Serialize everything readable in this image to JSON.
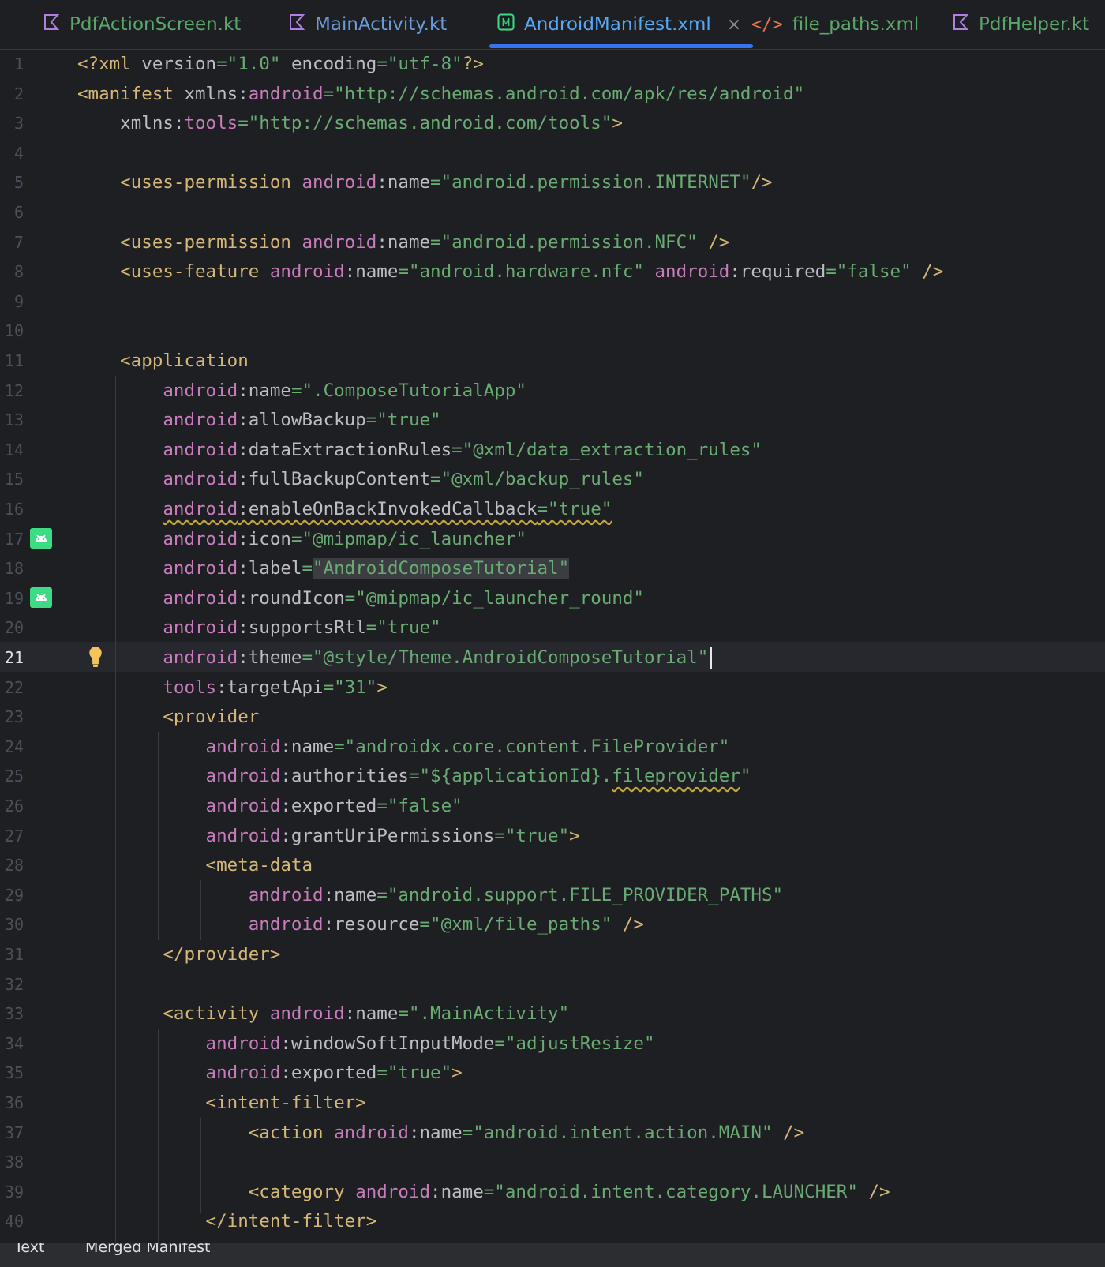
{
  "tabs": [
    {
      "label": "PdfActionScreen.kt",
      "icon": "kotlin-file-icon",
      "active": false
    },
    {
      "label": "MainActivity.kt",
      "icon": "kotlin-file-icon",
      "active": false
    },
    {
      "label": "AndroidManifest.xml",
      "icon": "manifest-file-icon",
      "active": true
    },
    {
      "label": "file_paths.xml",
      "icon": "xml-file-icon",
      "active": false
    },
    {
      "label": "PdfHelper.kt",
      "icon": "kotlin-file-icon",
      "active": false
    }
  ],
  "tab_close": "×",
  "lines": [
    {
      "n": "1",
      "segs": [
        {
          "c": "tag",
          "t": "<?xml "
        },
        {
          "c": "txt",
          "t": "version"
        },
        {
          "c": "str",
          "t": "=\"1.0\" "
        },
        {
          "c": "txt",
          "t": "encoding"
        },
        {
          "c": "str",
          "t": "=\"utf-8\""
        },
        {
          "c": "tag",
          "t": "?>"
        }
      ]
    },
    {
      "n": "2",
      "segs": [
        {
          "c": "tag",
          "t": "<manifest "
        },
        {
          "c": "txt",
          "t": "xmlns:"
        },
        {
          "c": "ns",
          "t": "android"
        },
        {
          "c": "str",
          "t": "=\"http://schemas.android.com/apk/res/android\""
        }
      ]
    },
    {
      "n": "3",
      "segs": [
        {
          "c": "txt",
          "t": "    xmlns:"
        },
        {
          "c": "ns",
          "t": "tools"
        },
        {
          "c": "str",
          "t": "=\"http://schemas.android.com/tools\""
        },
        {
          "c": "tag",
          "t": ">"
        }
      ]
    },
    {
      "n": "4",
      "segs": []
    },
    {
      "n": "5",
      "segs": [
        {
          "c": "tag",
          "t": "    <uses-permission "
        },
        {
          "c": "ns",
          "t": "android"
        },
        {
          "c": "txt",
          "t": ":name"
        },
        {
          "c": "str",
          "t": "=\"android.permission.INTERNET\""
        },
        {
          "c": "tag",
          "t": "/>"
        }
      ]
    },
    {
      "n": "6",
      "segs": []
    },
    {
      "n": "7",
      "segs": [
        {
          "c": "tag",
          "t": "    <uses-permission "
        },
        {
          "c": "ns",
          "t": "android"
        },
        {
          "c": "txt",
          "t": ":name"
        },
        {
          "c": "str",
          "t": "=\"android.permission.NFC\" "
        },
        {
          "c": "tag",
          "t": "/>"
        }
      ]
    },
    {
      "n": "8",
      "segs": [
        {
          "c": "tag",
          "t": "    <uses-feature "
        },
        {
          "c": "ns",
          "t": "android"
        },
        {
          "c": "txt",
          "t": ":name"
        },
        {
          "c": "str",
          "t": "=\"android.hardware.nfc\" "
        },
        {
          "c": "ns",
          "t": "android"
        },
        {
          "c": "txt",
          "t": ":required"
        },
        {
          "c": "str",
          "t": "=\"false\" "
        },
        {
          "c": "tag",
          "t": "/>"
        }
      ]
    },
    {
      "n": "9",
      "segs": []
    },
    {
      "n": "10",
      "segs": []
    },
    {
      "n": "11",
      "segs": [
        {
          "c": "tag",
          "t": "    <application"
        }
      ]
    },
    {
      "n": "12",
      "segs": [
        {
          "c": "ns",
          "t": "        android"
        },
        {
          "c": "txt",
          "t": ":name"
        },
        {
          "c": "str",
          "t": "=\".ComposeTutorialApp\""
        }
      ]
    },
    {
      "n": "13",
      "segs": [
        {
          "c": "ns",
          "t": "        android"
        },
        {
          "c": "txt",
          "t": ":allowBackup"
        },
        {
          "c": "str",
          "t": "=\"true\""
        }
      ]
    },
    {
      "n": "14",
      "segs": [
        {
          "c": "ns",
          "t": "        android"
        },
        {
          "c": "txt",
          "t": ":dataExtractionRules"
        },
        {
          "c": "str",
          "t": "=\"@xml/data_extraction_rules\""
        }
      ]
    },
    {
      "n": "15",
      "segs": [
        {
          "c": "ns",
          "t": "        android"
        },
        {
          "c": "txt",
          "t": ":fullBackupContent"
        },
        {
          "c": "str",
          "t": "=\"@xml/backup_rules\""
        }
      ]
    },
    {
      "n": "16",
      "segs": [
        {
          "c": "txt",
          "t": "        "
        },
        {
          "c": "ns wavy",
          "t": "android"
        },
        {
          "c": "txt wavy",
          "t": ":enableOnBackInvokedCallback"
        },
        {
          "c": "str wavy",
          "t": "=\"true\""
        }
      ]
    },
    {
      "n": "17",
      "segs": [
        {
          "c": "ns",
          "t": "        android"
        },
        {
          "c": "txt",
          "t": ":icon"
        },
        {
          "c": "str",
          "t": "=\"@mipmap/ic_launcher\""
        }
      ]
    },
    {
      "n": "18",
      "segs": [
        {
          "c": "ns",
          "t": "        android"
        },
        {
          "c": "txt",
          "t": ":label"
        },
        {
          "c": "str",
          "t": "="
        },
        {
          "c": "str hl-str",
          "t": "\"AndroidComposeTutorial\""
        }
      ]
    },
    {
      "n": "19",
      "segs": [
        {
          "c": "ns",
          "t": "        android"
        },
        {
          "c": "txt",
          "t": ":roundIcon"
        },
        {
          "c": "str",
          "t": "=\"@mipmap/ic_launcher_round\""
        }
      ]
    },
    {
      "n": "20",
      "segs": [
        {
          "c": "ns",
          "t": "        android"
        },
        {
          "c": "txt",
          "t": ":supportsRtl"
        },
        {
          "c": "str",
          "t": "=\"true\""
        }
      ]
    },
    {
      "n": "21",
      "segs": [
        {
          "c": "ns",
          "t": "        android"
        },
        {
          "c": "txt",
          "t": ":theme"
        },
        {
          "c": "str",
          "t": "=\"@style/Theme.AndroidComposeTutorial\""
        }
      ]
    },
    {
      "n": "22",
      "segs": [
        {
          "c": "ns",
          "t": "        tools"
        },
        {
          "c": "txt",
          "t": ":targetApi"
        },
        {
          "c": "str",
          "t": "=\"31\""
        },
        {
          "c": "tag",
          "t": ">"
        }
      ]
    },
    {
      "n": "23",
      "segs": [
        {
          "c": "tag",
          "t": "        <provider"
        }
      ]
    },
    {
      "n": "24",
      "segs": [
        {
          "c": "ns",
          "t": "            android"
        },
        {
          "c": "txt",
          "t": ":name"
        },
        {
          "c": "str",
          "t": "=\"androidx.core.content.FileProvider\""
        }
      ]
    },
    {
      "n": "25",
      "segs": [
        {
          "c": "ns",
          "t": "            android"
        },
        {
          "c": "txt",
          "t": ":authorities"
        },
        {
          "c": "str",
          "t": "=\"${applicationId}."
        },
        {
          "c": "str wavy",
          "t": "fileprovider"
        },
        {
          "c": "str",
          "t": "\""
        }
      ]
    },
    {
      "n": "26",
      "segs": [
        {
          "c": "ns",
          "t": "            android"
        },
        {
          "c": "txt",
          "t": ":exported"
        },
        {
          "c": "str",
          "t": "=\"false\""
        }
      ]
    },
    {
      "n": "27",
      "segs": [
        {
          "c": "ns",
          "t": "            android"
        },
        {
          "c": "txt",
          "t": ":grantUriPermissions"
        },
        {
          "c": "str",
          "t": "=\"true\""
        },
        {
          "c": "tag",
          "t": ">"
        }
      ]
    },
    {
      "n": "28",
      "segs": [
        {
          "c": "tag",
          "t": "            <meta-data"
        }
      ]
    },
    {
      "n": "29",
      "segs": [
        {
          "c": "ns",
          "t": "                android"
        },
        {
          "c": "txt",
          "t": ":name"
        },
        {
          "c": "str",
          "t": "=\"android.support.FILE_PROVIDER_PATHS\""
        }
      ]
    },
    {
      "n": "30",
      "segs": [
        {
          "c": "ns",
          "t": "                android"
        },
        {
          "c": "txt",
          "t": ":resource"
        },
        {
          "c": "str",
          "t": "=\"@xml/file_paths\" "
        },
        {
          "c": "tag",
          "t": "/>"
        }
      ]
    },
    {
      "n": "31",
      "segs": [
        {
          "c": "tag",
          "t": "        </provider>"
        }
      ]
    },
    {
      "n": "32",
      "segs": []
    },
    {
      "n": "33",
      "segs": [
        {
          "c": "tag",
          "t": "        <activity "
        },
        {
          "c": "ns",
          "t": "android"
        },
        {
          "c": "txt",
          "t": ":name"
        },
        {
          "c": "str",
          "t": "=\".MainActivity\""
        }
      ]
    },
    {
      "n": "34",
      "segs": [
        {
          "c": "ns",
          "t": "            android"
        },
        {
          "c": "txt",
          "t": ":windowSoftInputMode"
        },
        {
          "c": "str",
          "t": "=\"adjustResize\""
        }
      ]
    },
    {
      "n": "35",
      "segs": [
        {
          "c": "ns",
          "t": "            android"
        },
        {
          "c": "txt",
          "t": ":exported"
        },
        {
          "c": "str",
          "t": "=\"true\""
        },
        {
          "c": "tag",
          "t": ">"
        }
      ]
    },
    {
      "n": "36",
      "segs": [
        {
          "c": "tag",
          "t": "            <intent-filter>"
        }
      ]
    },
    {
      "n": "37",
      "segs": [
        {
          "c": "tag",
          "t": "                <action "
        },
        {
          "c": "ns",
          "t": "android"
        },
        {
          "c": "txt",
          "t": ":name"
        },
        {
          "c": "str",
          "t": "=\"android.intent.action.MAIN\" "
        },
        {
          "c": "tag",
          "t": "/>"
        }
      ]
    },
    {
      "n": "38",
      "segs": []
    },
    {
      "n": "39",
      "segs": [
        {
          "c": "tag",
          "t": "                <category "
        },
        {
          "c": "ns",
          "t": "android"
        },
        {
          "c": "txt",
          "t": ":name"
        },
        {
          "c": "str",
          "t": "=\"android.intent.category.LAUNCHER\" "
        },
        {
          "c": "tag",
          "t": "/>"
        }
      ]
    },
    {
      "n": "40",
      "segs": [
        {
          "c": "tag",
          "t": "            </intent-filter>"
        }
      ]
    }
  ],
  "current_line": "21",
  "gutter_icons": [
    {
      "line": "17",
      "icon": "android-icon"
    },
    {
      "line": "19",
      "icon": "android-icon"
    },
    {
      "line": "21",
      "icon": "lightbulb-icon"
    }
  ],
  "status": {
    "left": "Text",
    "right": "Merged Manifest"
  },
  "colors": {
    "tag": "#d5b778",
    "namespace": "#c77dbb",
    "string": "#6aab73",
    "text": "#bcbec4",
    "accent": "#3574f0"
  }
}
